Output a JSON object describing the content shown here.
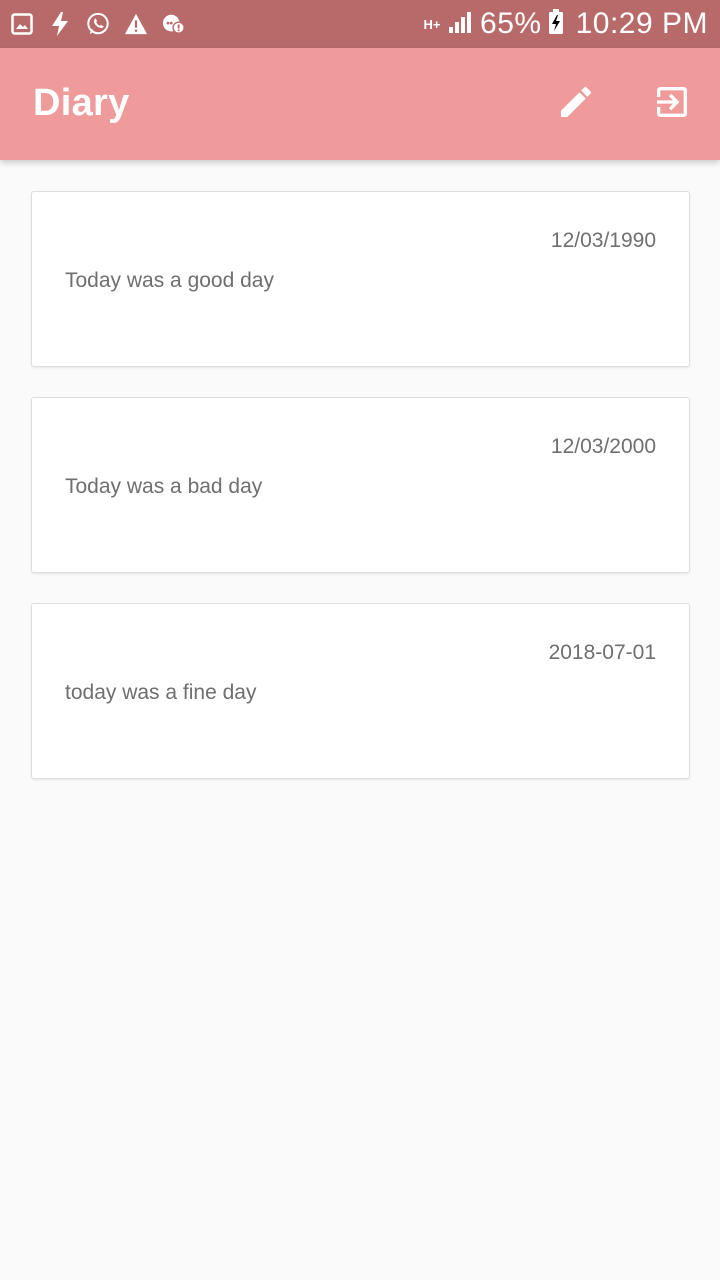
{
  "status_bar": {
    "left_icons": [
      "gallery-icon",
      "flash-icon",
      "whatsapp-icon",
      "warning-icon",
      "chat-alert-icon"
    ],
    "network": "H+",
    "battery_percent": "65%",
    "time": "10:29 PM"
  },
  "app_bar": {
    "title": "Diary",
    "actions": [
      "pencil-icon",
      "logout-icon"
    ],
    "color": "#ef9a9b"
  },
  "entries": [
    {
      "date": "12/03/1990",
      "text": "Today was a good day"
    },
    {
      "date": "12/03/2000",
      "text": "Today was a bad day"
    },
    {
      "date": "2018-07-01",
      "text": "today was a fine day"
    }
  ]
}
